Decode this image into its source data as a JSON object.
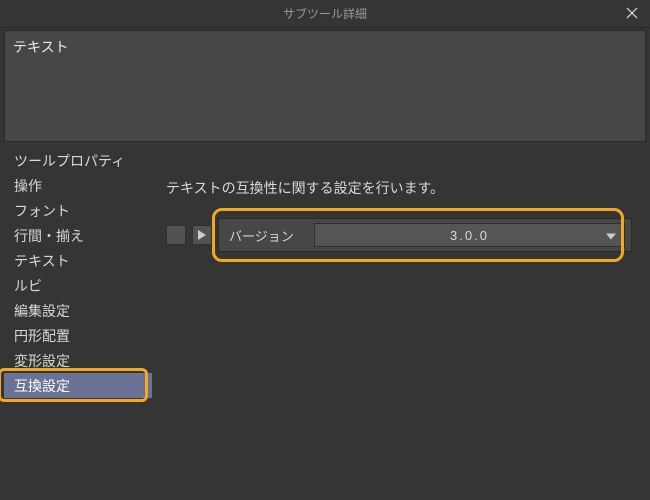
{
  "titlebar": {
    "title": "サブツール詳細"
  },
  "top_panel": {
    "text": "テキスト"
  },
  "sidebar": {
    "items": [
      {
        "label": "ツールプロパティ"
      },
      {
        "label": "操作"
      },
      {
        "label": "フォント"
      },
      {
        "label": "行間・揃え"
      },
      {
        "label": "テキスト"
      },
      {
        "label": "ルビ"
      },
      {
        "label": "編集設定"
      },
      {
        "label": "円形配置"
      },
      {
        "label": "変形設定"
      },
      {
        "label": "互換設定"
      }
    ],
    "selected_index": 9
  },
  "main": {
    "description": "テキストの互換性に関する設定を行います。",
    "version_label": "バージョン",
    "version_value": "3.0.0"
  }
}
